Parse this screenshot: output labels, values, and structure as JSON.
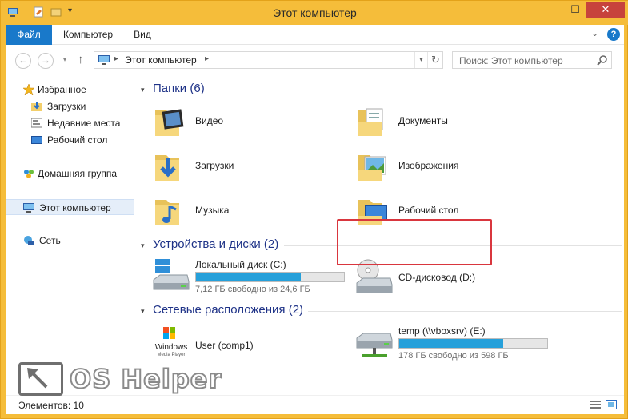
{
  "window": {
    "title": "Этот компьютер",
    "min_glyph": "—",
    "max_glyph": "☐",
    "close_glyph": "✕"
  },
  "ribbon": {
    "tabs": [
      "Файл",
      "Компьютер",
      "Вид"
    ],
    "expand_glyph": "⌄",
    "help_glyph": "?"
  },
  "nav": {
    "back_glyph": "←",
    "forward_glyph": "→",
    "history_glyph": "▾",
    "up_glyph": "↑",
    "address": {
      "location": "Этот компьютер",
      "sep_glyph": "▸",
      "dropdown_glyph": "▾",
      "refresh_glyph": "↻"
    },
    "search": {
      "placeholder": "Поиск: Этот компьютер",
      "icon": "search-icon"
    }
  },
  "sidebar": {
    "items": [
      {
        "label": "Избранное",
        "icon": "star-icon"
      },
      {
        "label": "Загрузки",
        "icon": "downloads-folder-icon"
      },
      {
        "label": "Недавние места",
        "icon": "recent-places-icon"
      },
      {
        "label": "Рабочий стол",
        "icon": "desktop-icon"
      },
      {
        "label": "Домашняя группа",
        "icon": "homegroup-icon"
      },
      {
        "label": "Этот компьютер",
        "icon": "computer-icon",
        "selected": true
      },
      {
        "label": "Сеть",
        "icon": "network-icon"
      }
    ]
  },
  "main": {
    "folders": {
      "heading": "Папки (6)",
      "items": [
        {
          "label": "Видео",
          "icon": "video-folder-icon"
        },
        {
          "label": "Документы",
          "icon": "documents-folder-icon"
        },
        {
          "label": "Загрузки",
          "icon": "downloads-folder-icon"
        },
        {
          "label": "Изображения",
          "icon": "pictures-folder-icon",
          "highlighted": true
        },
        {
          "label": "Музыка",
          "icon": "music-folder-icon"
        },
        {
          "label": "Рабочий стол",
          "icon": "desktop-folder-icon"
        }
      ]
    },
    "devices": {
      "heading": "Устройства и диски (2)",
      "items": [
        {
          "label": "Локальный диск (C:)",
          "icon": "windows-drive-icon",
          "usage": "7,12 ГБ свободно из 24,6 ГБ",
          "used_fraction": 0.71
        },
        {
          "label": "CD-дисковод (D:)",
          "icon": "cd-drive-icon"
        }
      ]
    },
    "network": {
      "heading": "Сетевые расположения (2)",
      "items": [
        {
          "label": "User (comp1)",
          "icon": "windows-media-player-icon",
          "logo_line1": "Windows",
          "logo_line2": "Media Player"
        },
        {
          "label": "temp (\\\\vboxsrv) (E:)",
          "icon": "network-drive-icon",
          "usage": "178 ГБ свободно из 598 ГБ",
          "used_fraction": 0.7
        }
      ]
    }
  },
  "status": {
    "items_text": "Элементов: 10"
  },
  "watermark": {
    "text": "OS Helper"
  },
  "colors": {
    "accent": "#1979ca",
    "frame": "#f5bd3a",
    "close": "#c7433c",
    "group_heading": "#1e3287",
    "highlight": "#d9363e",
    "bar_fill": "#26a0da"
  }
}
